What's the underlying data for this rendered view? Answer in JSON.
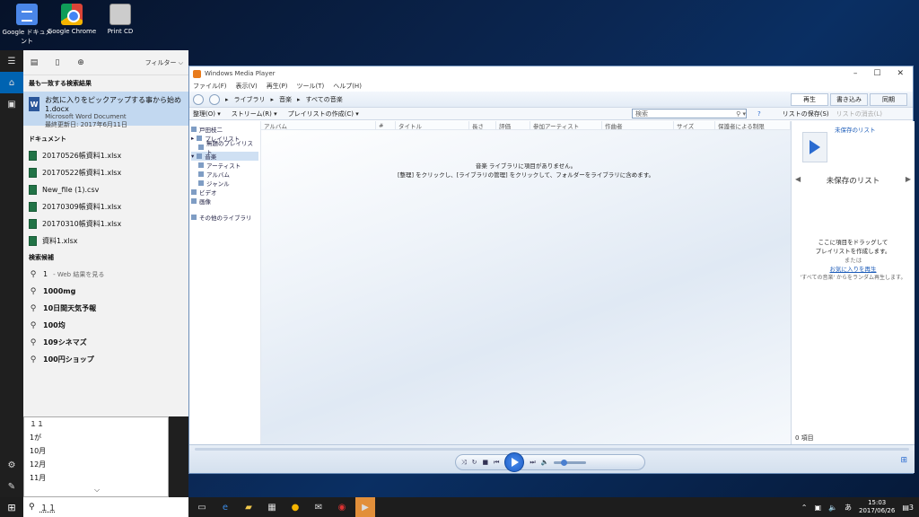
{
  "desktop": {
    "icons": [
      {
        "label": "Google ドキュメント"
      },
      {
        "label": "Google Chrome"
      },
      {
        "label": "Print CD"
      }
    ]
  },
  "search": {
    "filter_label": "フィルター",
    "best_match_heading": "最も一致する検索結果",
    "best_match": {
      "title": "お気に入りをピックアップする事から始め1.docx",
      "type": "Microsoft Word Document",
      "modified": "最終更新日: 2017年6月11日"
    },
    "documents_heading": "ドキュメント",
    "documents": [
      {
        "name": "20170526帳資料1.xlsx"
      },
      {
        "name": "20170522帳資料1.xlsx"
      },
      {
        "name": "New_file (1).csv"
      },
      {
        "name": "20170309帳資料1.xlsx"
      },
      {
        "name": "20170310帳資料1.xlsx"
      },
      {
        "name": "資料1.xlsx"
      }
    ],
    "suggestions_heading": "検索候補",
    "web_suggestion": {
      "query": "1",
      "hint": "- Web 結果を見る"
    },
    "suggestions": [
      "1000mg",
      "10日間天気予報",
      "100均",
      "109シネマズ",
      "100円ショップ"
    ],
    "query": "１１"
  },
  "ime": {
    "candidates": [
      "１１",
      "1が",
      "10月",
      "12月",
      "11月"
    ]
  },
  "wmp": {
    "title": "Windows Media Player",
    "menu": [
      "ファイル(F)",
      "表示(V)",
      "再生(P)",
      "ツール(T)",
      "ヘルプ(H)"
    ],
    "breadcrumb": [
      "ライブラリ",
      "音楽",
      "すべての音楽"
    ],
    "tabs": [
      "再生",
      "書き込み",
      "同期"
    ],
    "toolbar": [
      "整理(O)",
      "ストリーム(R)",
      "プレイリストの作成(C)"
    ],
    "search_placeholder": "検索",
    "save_list": "リストの保存(S)",
    "clear_list": "リストの消去(L)",
    "tree": {
      "user": "戸田枝二",
      "playlists": "プレイリスト",
      "untitled_playlist": "無題のプレイリスト",
      "music": "音楽",
      "artist": "アーティスト",
      "album": "アルバム",
      "genre": "ジャンル",
      "video": "ビデオ",
      "pictures": "画像",
      "other_libraries": "その他のライブラリ"
    },
    "columns": [
      "アルバム",
      "#",
      "タイトル",
      "長さ",
      "評価",
      "参加アーティスト",
      "作曲者",
      "サイズ",
      "保護者による制限"
    ],
    "empty_line1": "音楽 ライブラリに項目がありません。",
    "empty_line2": "[整理] をクリックし、[ライブラリの管理] をクリックして、フォルダーをライブラリに含めます。",
    "list_pane": {
      "unsaved_link": "未保存のリスト",
      "unsaved_title": "未保存のリスト",
      "drop_line1": "ここに項目をドラッグして",
      "drop_line2": "プレイリストを作成します。",
      "or": "または",
      "fav_link": "お気に入りを再生",
      "random_hint": "'すべての音楽' からをランダム再生します。",
      "count": "0 項目"
    }
  },
  "clock": {
    "time": "15:03",
    "date": "2017/06/26"
  },
  "tray": {
    "ime_mode": "あ",
    "notifications": "3"
  }
}
